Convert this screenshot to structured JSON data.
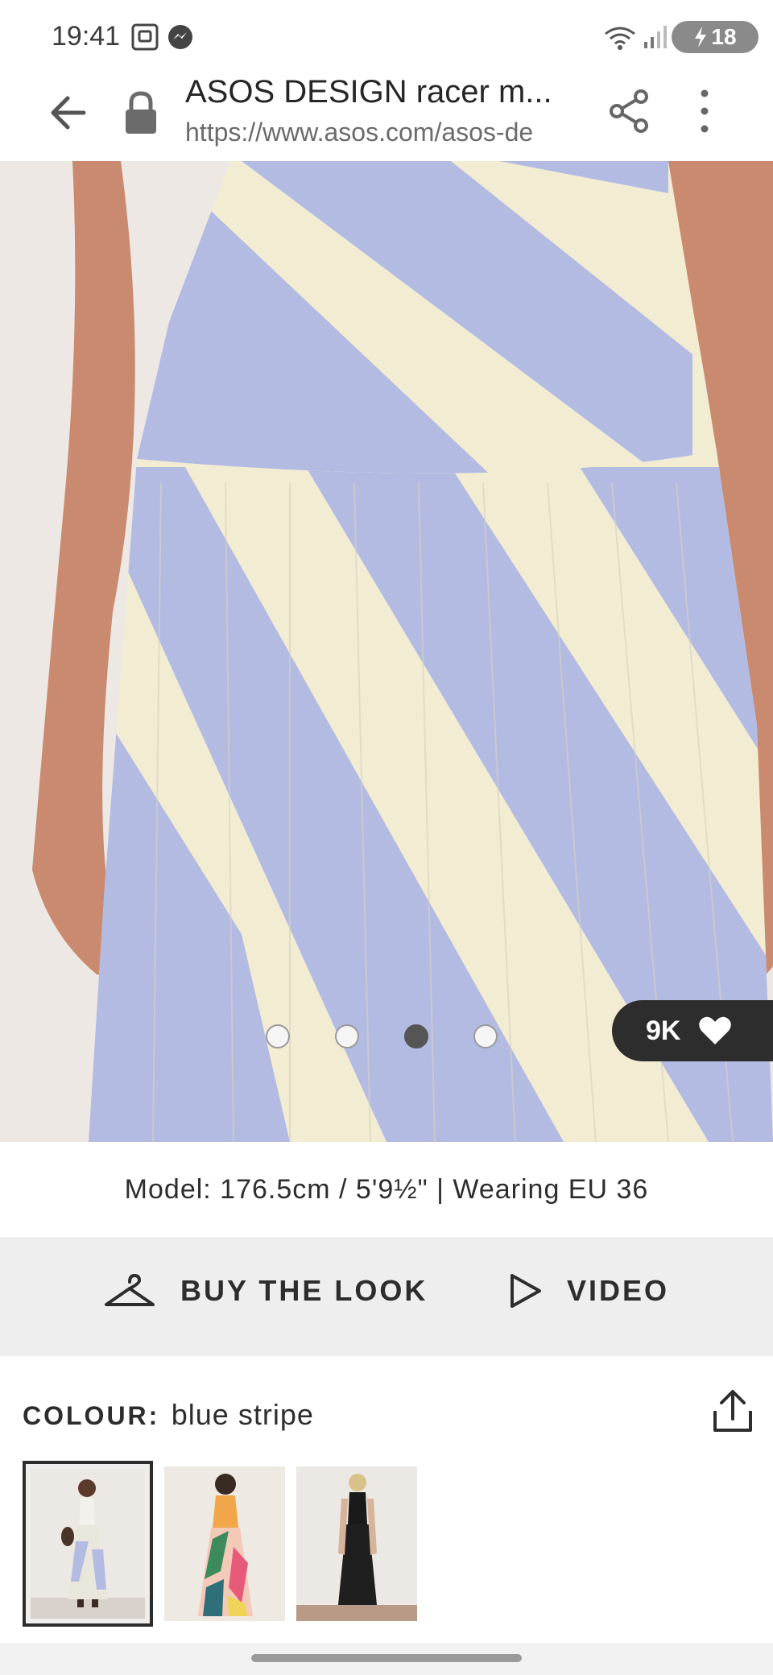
{
  "status_bar": {
    "time": "19:41",
    "battery_level": "18",
    "icons": [
      "screenshot-icon",
      "messenger-icon",
      "wifi-icon",
      "signal-icon",
      "battery-charging-icon"
    ]
  },
  "browser": {
    "title": "ASOS DESIGN racer m...",
    "url": "https://www.asos.com/asos-de",
    "icons": [
      "back-arrow-icon",
      "lock-icon",
      "share-icon",
      "more-vert-icon"
    ]
  },
  "gallery": {
    "image_count": 4,
    "active_index": 2,
    "likes": "9K",
    "colors": {
      "stripe_blue": "#b3bbe3",
      "stripe_cream": "#f2ecd3",
      "skin": "#c98a6f",
      "background": "#ede8e4"
    }
  },
  "model_info": "Model: 176.5cm / 5'9½\" | Wearing EU 36",
  "actions": {
    "buy_the_look": "BUY THE LOOK",
    "video": "VIDEO"
  },
  "colour": {
    "label": "COLOUR:",
    "value": "blue stripe"
  },
  "swatches": [
    {
      "name": "blue stripe",
      "selected": true
    },
    {
      "name": "multi print",
      "selected": false
    },
    {
      "name": "black",
      "selected": false
    }
  ]
}
